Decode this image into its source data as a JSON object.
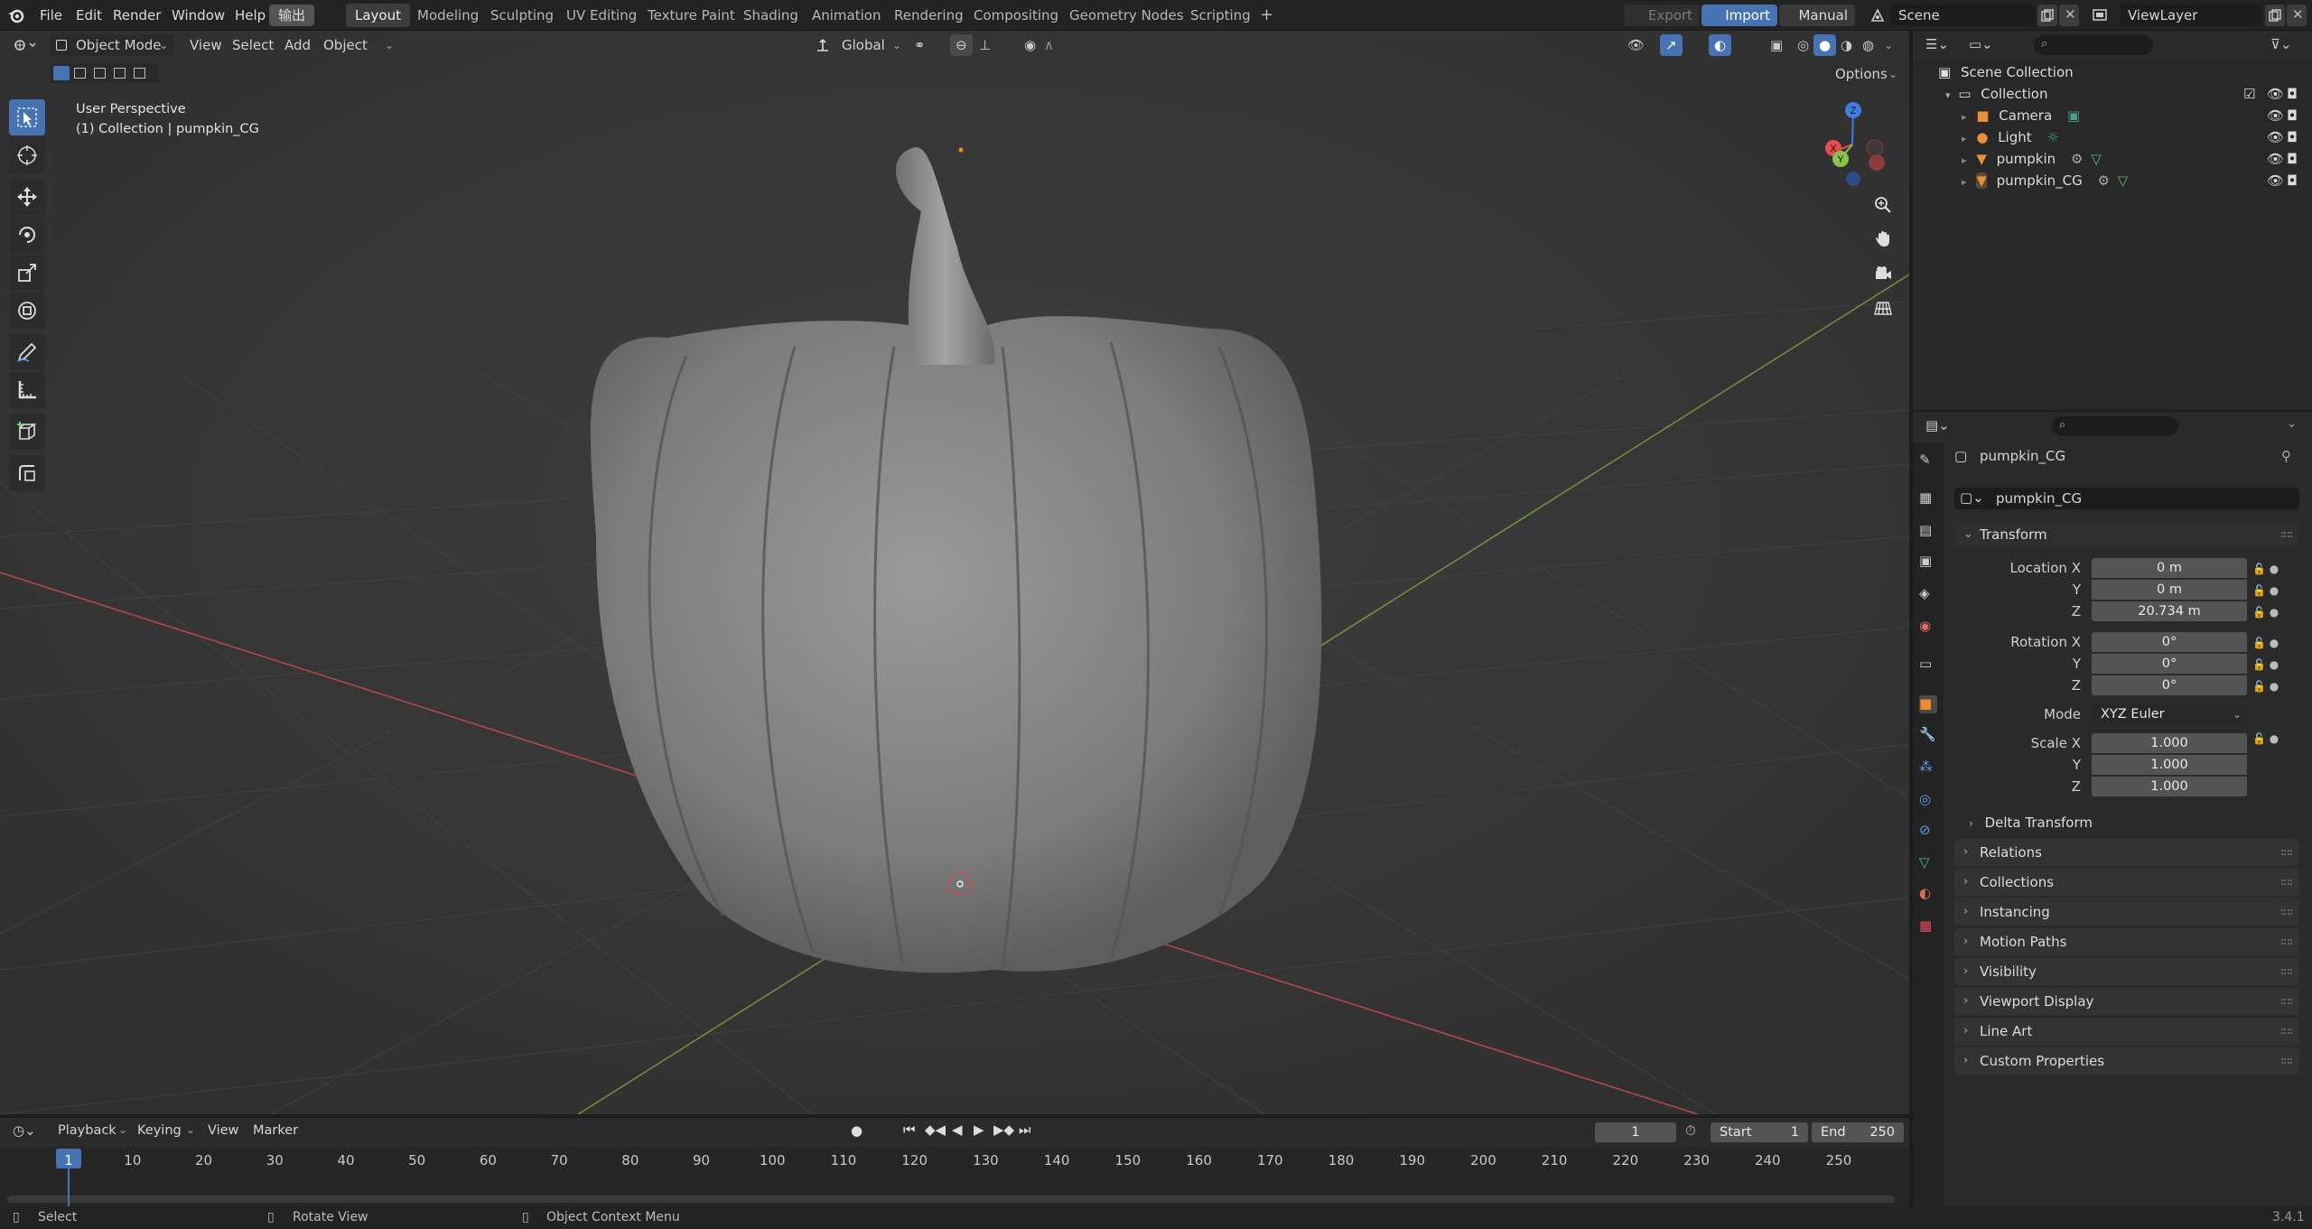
{
  "topbar": {
    "menus": [
      "File",
      "Edit",
      "Render",
      "Window",
      "Help"
    ],
    "highlight_menu": "输出",
    "workspaces": [
      "Layout",
      "Modeling",
      "Sculpting",
      "UV Editing",
      "Texture Paint",
      "Shading",
      "Animation",
      "Rendering",
      "Compositing",
      "Geometry Nodes",
      "Scripting"
    ],
    "add_tab": "+",
    "export_label": "Export",
    "import_label": "Import",
    "manual_label": "Manual",
    "scene_name": "Scene",
    "view_layer": "ViewLayer"
  },
  "viewport_header": {
    "mode": "Object Mode",
    "menus": [
      "View",
      "Select",
      "Add",
      "Object"
    ],
    "transform_orientation": "Global",
    "options_label": "Options"
  },
  "viewport": {
    "perspective": "User Perspective",
    "collection_info": "(1) Collection | pumpkin_CG",
    "gizmo_axes": {
      "x": "X",
      "y": "Y",
      "z": "Z"
    },
    "colors": {
      "x_axis": "#e84d4d",
      "y_axis": "#8bc34a",
      "z_axis": "#3d7ee0",
      "grid_bg": "#393939"
    }
  },
  "outliner": {
    "root": "Scene Collection",
    "collection": "Collection",
    "items": [
      {
        "name": "Camera",
        "icon": "camera-icon"
      },
      {
        "name": "Light",
        "icon": "light-icon"
      },
      {
        "name": "pumpkin",
        "icon": "mesh-icon"
      },
      {
        "name": "pumpkin_CG",
        "icon": "mesh-icon"
      }
    ]
  },
  "properties": {
    "object_name": "pumpkin_CG",
    "datablock_name": "pumpkin_CG",
    "transform_title": "Transform",
    "location": {
      "label": "Location X",
      "x": "0 m",
      "y": "0 m",
      "z": "20.734 m"
    },
    "rotation": {
      "label": "Rotation X",
      "x": "0°",
      "y": "0°",
      "z": "0°"
    },
    "mode_label": "Mode",
    "mode_value": "XYZ Euler",
    "scale": {
      "label": "Scale X",
      "x": "1.000",
      "y": "1.000",
      "z": "1.000"
    },
    "axis_y": "Y",
    "axis_z": "Z",
    "delta_transform": "Delta Transform",
    "panels": [
      "Relations",
      "Collections",
      "Instancing",
      "Motion Paths",
      "Visibility",
      "Viewport Display",
      "Line Art",
      "Custom Properties"
    ]
  },
  "timeline": {
    "menus": [
      "Playback",
      "Keying",
      "View",
      "Marker"
    ],
    "current_frame": "1",
    "start_label": "Start",
    "start_value": "1",
    "end_label": "End",
    "end_value": "250",
    "ticks": [
      "1",
      "10",
      "20",
      "30",
      "40",
      "50",
      "60",
      "70",
      "80",
      "90",
      "100",
      "110",
      "120",
      "130",
      "140",
      "150",
      "160",
      "170",
      "180",
      "190",
      "200",
      "210",
      "220",
      "230",
      "240",
      "250"
    ]
  },
  "statusbar": {
    "select": "Select",
    "rotate_view": "Rotate View",
    "context_menu": "Object Context Menu",
    "version": "3.4.1"
  }
}
